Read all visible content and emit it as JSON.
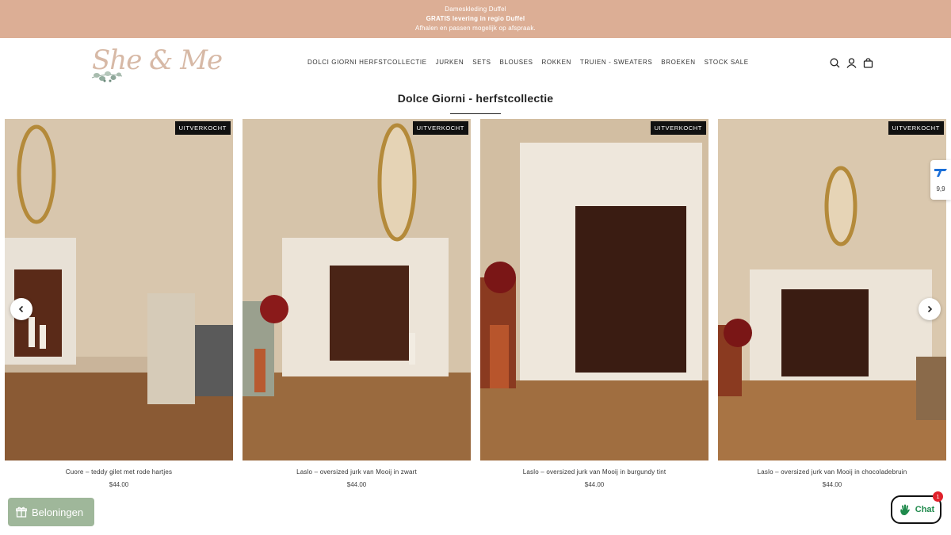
{
  "announcement": {
    "line1": "Dameskleding Duffel",
    "line2": "GRATIS levering in regio Duffel",
    "line3": "Afhalen en passen mogelijk op afspraak."
  },
  "header": {
    "logo_text": "She & Me",
    "nav": [
      "DOLCI GIORNI HERFSTCOLLECTIE",
      "JURKEN",
      "SETS",
      "BLOUSES",
      "ROKKEN",
      "TRUIEN - SWEATERS",
      "BROEKEN",
      "STOCK SALE"
    ],
    "icons": [
      "search-icon",
      "account-icon",
      "cart-icon"
    ]
  },
  "collection": {
    "title": "Dolce Giorni - herfstcollectie"
  },
  "products": [
    {
      "name": "Cuore – teddy gilet met rode hartjes",
      "price": "$44.00",
      "badge": "UITVERKOCHT",
      "dress_color": "#9b1f1a"
    },
    {
      "name": "Laslo – oversized jurk van Mooij in zwart",
      "price": "$44.00",
      "badge": "UITVERKOCHT",
      "dress_color": "#1a1a1a"
    },
    {
      "name": "Laslo – oversized jurk van Mooij in burgundy tint",
      "price": "$44.00",
      "badge": "UITVERKOCHT",
      "dress_color": "#8a1a12"
    },
    {
      "name": "Laslo – oversized jurk van Mooij in chocoladebruin",
      "price": "$44.00",
      "badge": "UITVERKOCHT",
      "dress_color": "#3a2018"
    }
  ],
  "review_badge": {
    "score": "9,9"
  },
  "rewards": {
    "label": "Beloningen"
  },
  "chat": {
    "label": "Chat",
    "badge_count": "1"
  },
  "colors": {
    "announcement_bg": "#dcae95",
    "rewards_bg": "#9fb79a",
    "chat_text": "#1f8a4c",
    "chat_badge": "#e0212b"
  }
}
